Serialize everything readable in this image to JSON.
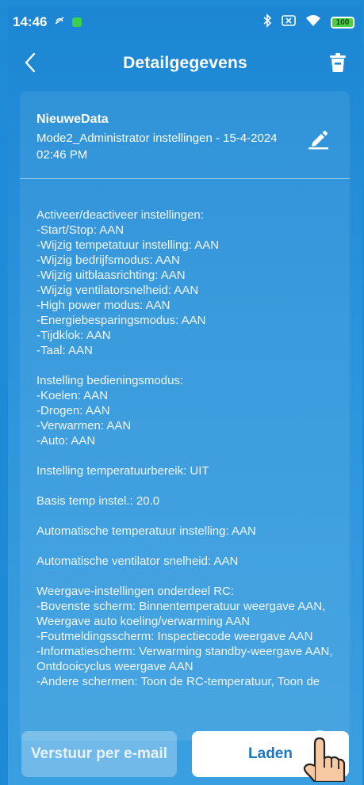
{
  "status_bar": {
    "time": "14:46",
    "battery": "100"
  },
  "header": {
    "title": "Detailgegevens"
  },
  "card": {
    "name": "NieuweData",
    "subtitle": "Mode2_Administrator instellingen - 15-4-2024 02:46 PM",
    "details": "Activeer/deactiveer instellingen:\n-Start/Stop: AAN\n-Wijzig tempetatuur instelling: AAN\n-Wijzig bedrijfsmodus: AAN\n-Wijzig uitblaasrichting: AAN\n-Wijzig ventilatorsnelheid: AAN\n-High power modus: AAN\n-Energiebesparingsmodus: AAN\n-Tijdklok: AAN\n-Taal: AAN\n\nInstelling bedieningsmodus:\n-Koelen: AAN\n-Drogen: AAN\n-Verwarmen: AAN\n-Auto: AAN\n\nInstelling temperatuurbereik: UIT\n\nBasis temp instel.: 20.0\n\nAutomatische temperatuur instelling: AAN\n\nAutomatische ventilator snelheid: AAN\n\nWeergave-instellingen onderdeel RC:\n-Bovenste scherm: Binnentemperatuur weergave AAN, Weergave auto koeling/verwarming AAN\n-Foutmeldingsscherm: Inspectiecode weergave AAN\n-Informatiescherm: Verwarming standby-weergave AAN, Ontdooicyclus weergave AAN\n-Andere schermen: Toon de RC-temperatuur, Toon de"
  },
  "buttons": {
    "email": "Verstuur per e-mail",
    "load": "Laden"
  },
  "colors": {
    "background": "#1f8ad6",
    "accent": "#1a78c8"
  }
}
